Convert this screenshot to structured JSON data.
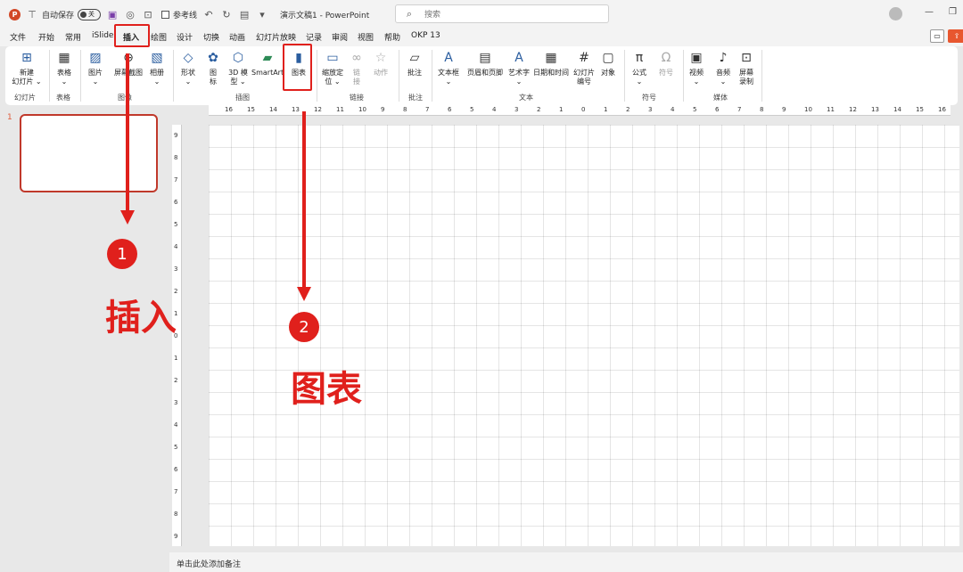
{
  "titlebar": {
    "autosave_label": "自动保存",
    "autosave_state": "关",
    "reference_label": "参考线",
    "doc_title": "演示文稿1  -  PowerPoint",
    "search_placeholder": "搜索"
  },
  "menu": {
    "tabs": [
      "文件",
      "开始",
      "常用",
      "iSlide",
      "插入",
      "绘图",
      "设计",
      "切换",
      "动画",
      "幻灯片放映",
      "记录",
      "审阅",
      "视图",
      "帮助",
      "OKP 13"
    ],
    "active": "插入"
  },
  "ribbon": {
    "new_slide": "新建\n幻灯片 ⌄",
    "table": "表格\n⌄",
    "picture": "图片\n⌄",
    "screenshot": "屏幕截图",
    "album": "相册\n⌄",
    "shapes": "形状\n⌄",
    "icons": "图\n标",
    "model3d": "3D 模\n型 ⌄",
    "smartart": "SmartArt",
    "chart": "图表",
    "zoom": "缩放定\n位 ⌄",
    "link": "链\n接",
    "action": "动作",
    "comment": "批注",
    "textbox": "文本框\n⌄",
    "header_footer": "页眉和页脚",
    "wordart": "艺术字\n⌄",
    "datetime": "日期和时间",
    "slide_number": "幻灯片\n编号",
    "object": "对象",
    "equation": "公式\n⌄",
    "symbol": "符号",
    "video": "视频\n⌄",
    "audio": "音频\n⌄",
    "screen_record": "屏幕\n录制",
    "groups": {
      "slides": "幻灯片",
      "tables": "表格",
      "images": "图像",
      "illustrations": "插图",
      "links": "链接",
      "comments": "批注",
      "text": "文本",
      "symbols": "符号",
      "media": "媒体"
    }
  },
  "ruler": {
    "h_ticks": [
      "16",
      "15",
      "14",
      "13",
      "12",
      "11",
      "10",
      "9",
      "8",
      "7",
      "6",
      "5",
      "4",
      "3",
      "2",
      "1",
      "0",
      "1",
      "2",
      "3",
      "4",
      "5",
      "6",
      "7",
      "8",
      "9",
      "10",
      "11",
      "12",
      "13",
      "14",
      "15",
      "16"
    ],
    "v_ticks": [
      "9",
      "8",
      "7",
      "6",
      "5",
      "4",
      "3",
      "2",
      "1",
      "0",
      "1",
      "2",
      "3",
      "4",
      "5",
      "6",
      "7",
      "8",
      "9"
    ]
  },
  "slides_panel": {
    "slide_number": "1"
  },
  "notes": {
    "placeholder": "单击此处添加备注"
  },
  "annotations": {
    "step1_number": "1",
    "step1_label": "插入",
    "step2_number": "2",
    "step2_label": "图表"
  }
}
